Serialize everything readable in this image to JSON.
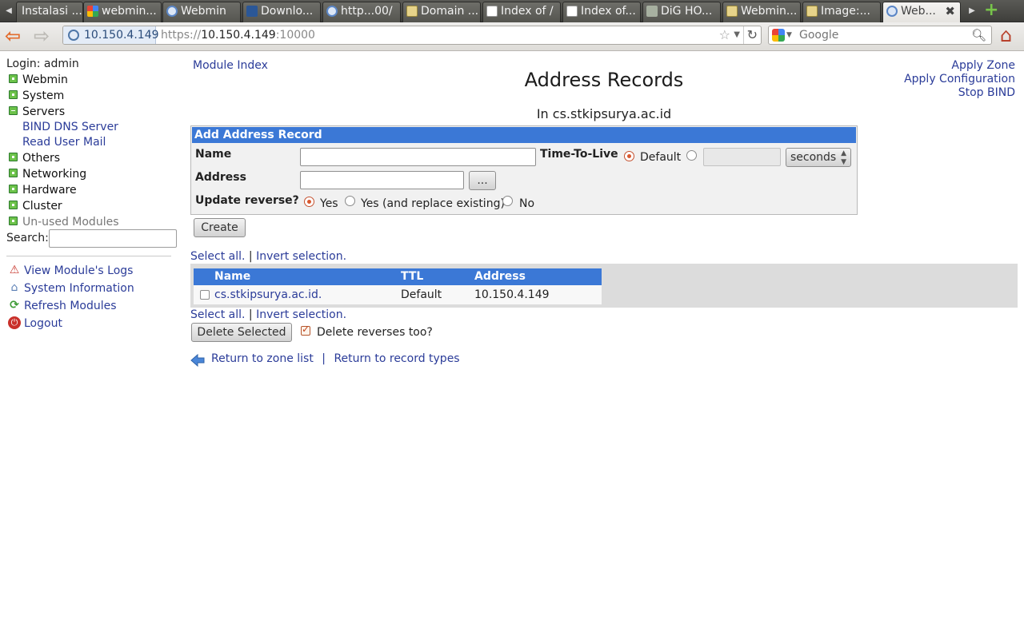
{
  "browser": {
    "tabs": [
      {
        "label": "Instalasi ...",
        "icon": "none"
      },
      {
        "label": "webmin...",
        "icon": "google-icon"
      },
      {
        "label": "Webmin",
        "icon": "webmin-icon"
      },
      {
        "label": "Downlo...",
        "icon": "sourceforge-icon"
      },
      {
        "label": "http...00/",
        "icon": "webmin-icon"
      },
      {
        "label": "Domain ...",
        "icon": "folder-icon"
      },
      {
        "label": "Index of /",
        "icon": "page-icon"
      },
      {
        "label": "Index of...",
        "icon": "page-icon"
      },
      {
        "label": "DiG HO...",
        "icon": "dig-icon"
      },
      {
        "label": "Webmin...",
        "icon": "folder-icon"
      },
      {
        "label": "Image:...",
        "icon": "folder-icon"
      },
      {
        "label": "Web...",
        "icon": "webmin-icon"
      }
    ],
    "site_identity": "10.150.4.149",
    "url_scheme": "https://",
    "url_host": "10.150.4.149",
    "url_port": ":10000",
    "search_placeholder": "Google"
  },
  "sidebar": {
    "login": "Login: admin",
    "categories": [
      {
        "label": "Webmin",
        "open": false
      },
      {
        "label": "System",
        "open": false
      },
      {
        "label": "Servers",
        "open": true
      },
      {
        "label": "Others",
        "open": false
      },
      {
        "label": "Networking",
        "open": false
      },
      {
        "label": "Hardware",
        "open": false
      },
      {
        "label": "Cluster",
        "open": false
      },
      {
        "label": "Un-used Modules",
        "open": false
      }
    ],
    "server_modules": [
      "BIND DNS Server",
      "Read User Mail"
    ],
    "search_label": "Search:",
    "links": [
      {
        "label": "View Module's Logs",
        "icon": "warning-icon"
      },
      {
        "label": "System Information",
        "icon": "house-icon"
      },
      {
        "label": "Refresh Modules",
        "icon": "refresh-icon"
      },
      {
        "label": "Logout",
        "icon": "power-icon"
      }
    ]
  },
  "main": {
    "module_index": "Module Index",
    "title": "Address Records",
    "right_links": [
      "Apply Zone",
      "Apply Configuration",
      "Stop BIND"
    ],
    "subtitle": "In cs.stkipsurya.ac.id",
    "form": {
      "header": "Add Address Record",
      "name_label": "Name",
      "name_value": "",
      "ttl_label": "Time-To-Live",
      "ttl_default_label": "Default",
      "ttl_selected": "Default",
      "ttl_value": "",
      "ttl_unit": "seconds",
      "address_label": "Address",
      "address_value": "",
      "address_button": "...",
      "reverse_label": "Update reverse?",
      "reverse_options": [
        "Yes",
        "Yes (and replace existing)",
        "No"
      ],
      "reverse_selected": "Yes",
      "create_button": "Create"
    },
    "select_all": "Select all.",
    "invert_selection": "Invert selection.",
    "table": {
      "columns": [
        "Name",
        "TTL",
        "Address"
      ],
      "rows": [
        {
          "name": "cs.stkipsurya.ac.id.",
          "ttl": "Default",
          "address": "10.150.4.149",
          "checked": false
        }
      ]
    },
    "delete_button": "Delete Selected",
    "delete_reverses_label": "Delete reverses too?",
    "delete_reverses_checked": true,
    "return_zone": "Return to zone list",
    "return_types": "Return to record types",
    "link_separator": "|"
  }
}
